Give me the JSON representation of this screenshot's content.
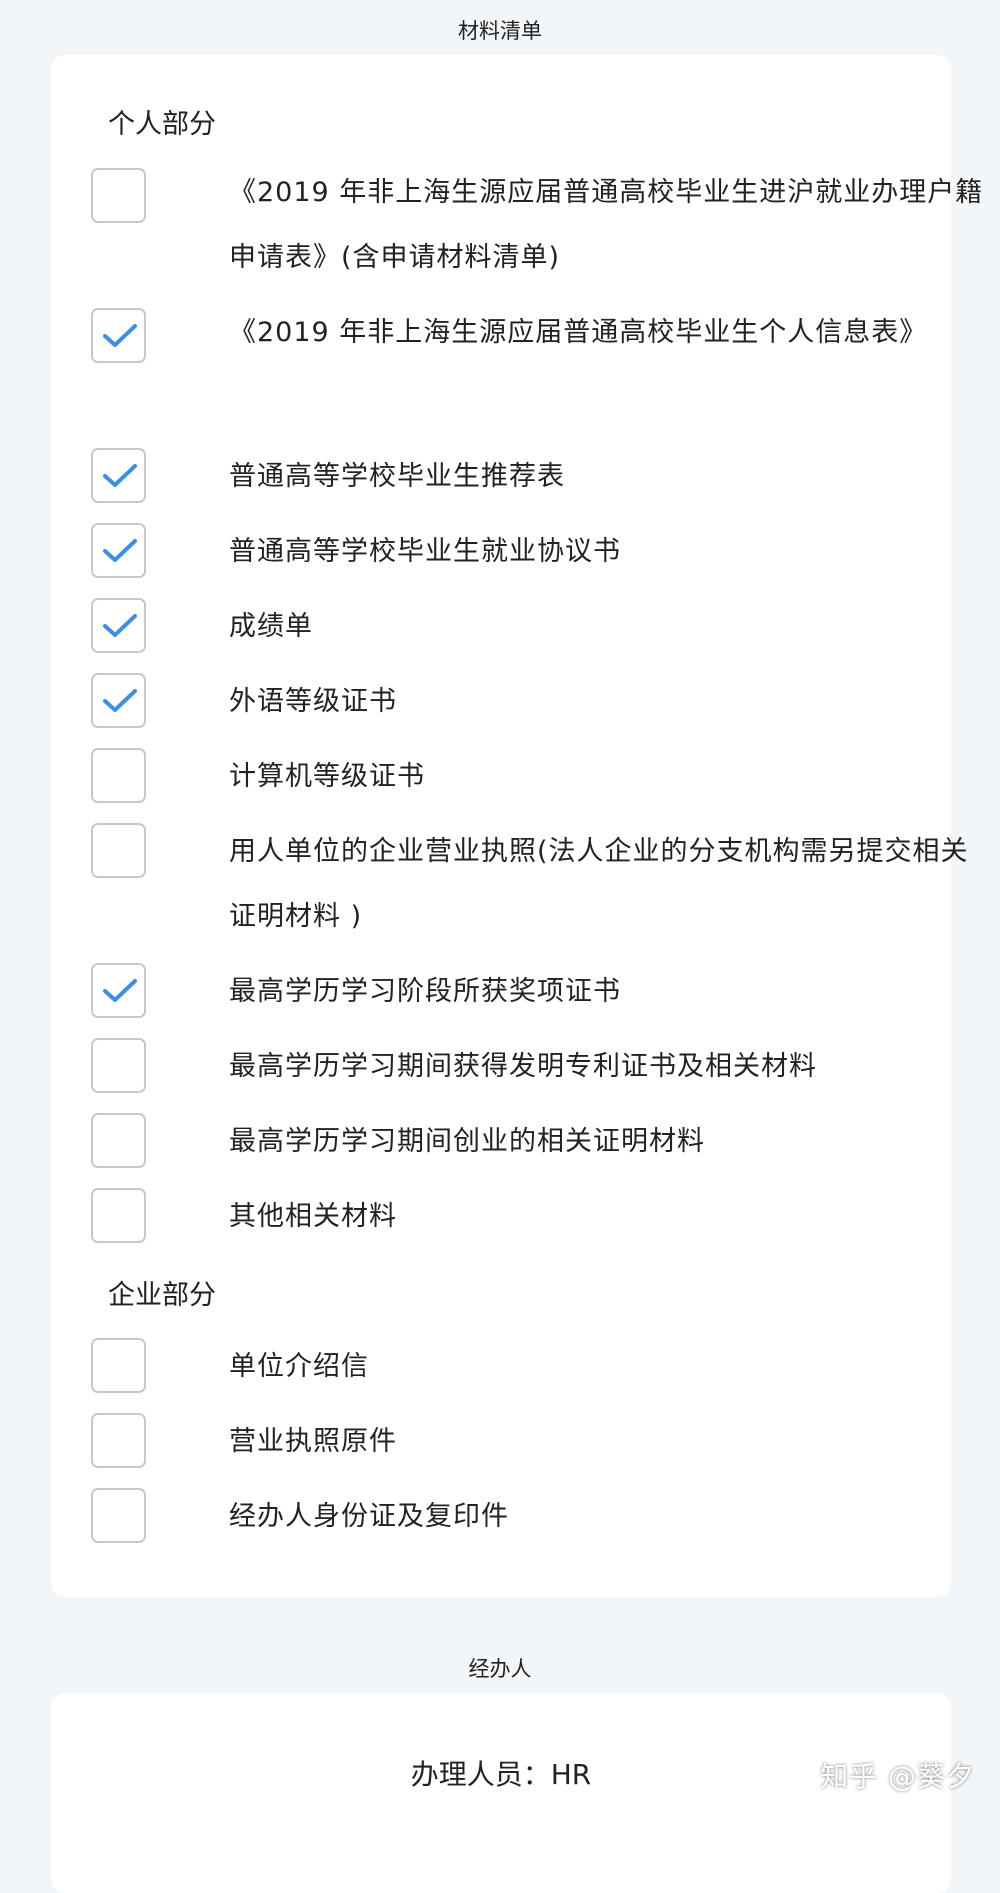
{
  "header": {
    "title": "材料清单"
  },
  "personal": {
    "heading": "个人部分",
    "items": [
      {
        "label": "《2019 年非上海生源应届普通高校毕业生进沪就业办理户籍申请表》(含申请材料清单)",
        "checked": false
      },
      {
        "label": "《2019 年非上海生源应届普通高校毕业生个人信息表》",
        "checked": true
      },
      {
        "label": "普通高等学校毕业生推荐表",
        "checked": true
      },
      {
        "label": "普通高等学校毕业生就业协议书",
        "checked": true
      },
      {
        "label": "成绩单",
        "checked": true
      },
      {
        "label": "外语等级证书",
        "checked": true
      },
      {
        "label": "计算机等级证书",
        "checked": false
      },
      {
        "label": "用人单位的企业营业执照(法人企业的分支机构需另提交相关证明材料 )",
        "checked": false
      },
      {
        "label": "最高学历学习阶段所获奖项证书",
        "checked": true
      },
      {
        "label": "最高学历学习期间获得发明专利证书及相关材料",
        "checked": false
      },
      {
        "label": "最高学历学习期间创业的相关证明材料",
        "checked": false
      },
      {
        "label": "其他相关材料",
        "checked": false
      }
    ]
  },
  "enterprise": {
    "heading": "企业部分",
    "items": [
      {
        "label": "单位介绍信",
        "checked": false
      },
      {
        "label": "营业执照原件",
        "checked": false
      },
      {
        "label": "经办人身份证及复印件",
        "checked": false
      }
    ]
  },
  "handler": {
    "section_title": "经办人",
    "label": "办理人员：",
    "value": "HR"
  },
  "watermark": "知乎 @葵夕",
  "colors": {
    "check": "#3d8fe0",
    "background": "#f3f6f8",
    "card": "#ffffff",
    "checkbox_border": "#c9c9c9"
  }
}
